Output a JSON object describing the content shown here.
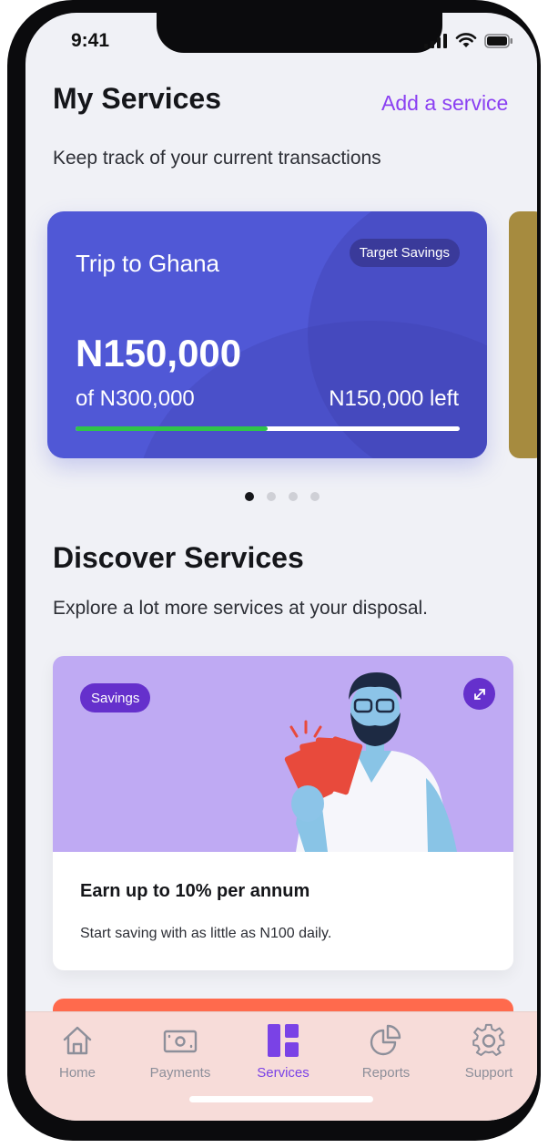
{
  "status": {
    "time": "9:41"
  },
  "header": {
    "title": "My Services",
    "add_link": "Add a service",
    "subtitle": "Keep track of your current transactions"
  },
  "savings_card": {
    "name": "Trip to Ghana",
    "badge": "Target Savings",
    "amount": "N150,000",
    "of_total": "of N300,000",
    "remaining": "N150,000 left",
    "progress": 0.5,
    "progress_color": "#2fc34a",
    "card_color": "#5058d6"
  },
  "carousel": {
    "pages": 4,
    "active": 0
  },
  "discover": {
    "title": "Discover Services",
    "subtitle": "Explore a lot more services at your disposal.",
    "card": {
      "badge": "Savings",
      "headline": "Earn up to 10% per annum",
      "description": "Start saving with as little as N100 daily.",
      "banner_color": "#bfaaf3",
      "illustration": "man-with-cash-illustration",
      "expand_icon": "expand-icon"
    }
  },
  "tabs": [
    {
      "label": "Home",
      "icon": "home-icon"
    },
    {
      "label": "Payments",
      "icon": "banknote-icon"
    },
    {
      "label": "Services",
      "icon": "grid-icon",
      "active": true
    },
    {
      "label": "Reports",
      "icon": "pie-chart-icon"
    },
    {
      "label": "Support",
      "icon": "gear-icon"
    }
  ],
  "colors": {
    "accent": "#8a3ff2",
    "tab_active": "#7a42e6",
    "tabbar_bg": "#f7dcd9"
  }
}
